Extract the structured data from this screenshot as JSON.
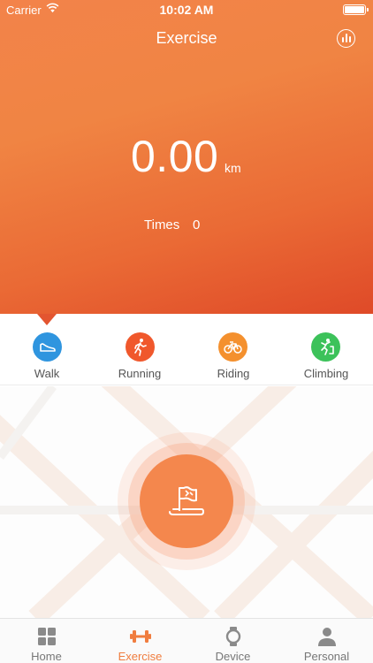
{
  "status_bar": {
    "carrier": "Carrier",
    "time": "10:02 AM"
  },
  "header": {
    "title": "Exercise",
    "stats_icon": "bar-chart-icon"
  },
  "summary": {
    "distance": "0.00",
    "unit": "km",
    "times_label": "Times",
    "times_value": "0"
  },
  "modes": [
    {
      "label": "Walk",
      "icon": "shoe-icon",
      "color": "#2f95df",
      "selected": true
    },
    {
      "label": "Running",
      "icon": "runner-icon",
      "color": "#f0582c"
    },
    {
      "label": "Riding",
      "icon": "bicycle-icon",
      "color": "#f4902e"
    },
    {
      "label": "Climbing",
      "icon": "climber-icon",
      "color": "#3cc25a"
    }
  ],
  "start_button": {
    "icon": "flag-icon",
    "color": "#f4874d"
  },
  "tabbar": {
    "items": [
      {
        "label": "Home",
        "icon": "grid-icon"
      },
      {
        "label": "Exercise",
        "icon": "dumbbell-icon",
        "active": true
      },
      {
        "label": "Device",
        "icon": "watch-icon"
      },
      {
        "label": "Personal",
        "icon": "person-icon"
      }
    ],
    "active_color": "#f07d3f"
  }
}
